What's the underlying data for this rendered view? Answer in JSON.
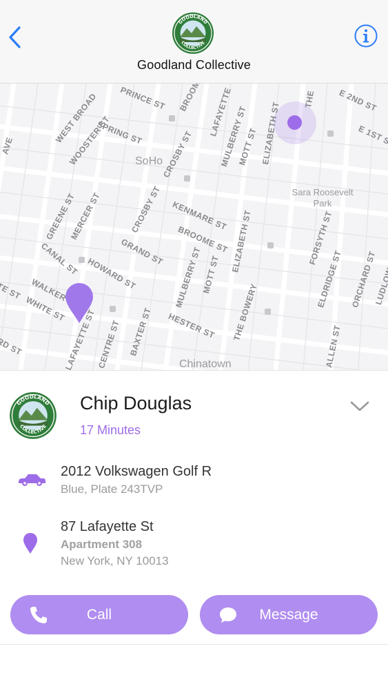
{
  "header": {
    "title": "Goodland Collective",
    "back_icon": "chevron-left-icon",
    "info_icon": "info-icon",
    "logo_name": "goodland-collective-logo",
    "logo_text_top": "GOODLAND",
    "logo_text_bottom": "COLLECTIVE"
  },
  "map": {
    "area_labels": [
      "SoHo",
      "Chinatown"
    ],
    "park_label": [
      "Sara Roosevelt",
      "Park"
    ],
    "streets": [
      "PRINCE ST",
      "WEST BROAD",
      "WOOSTER ST",
      "SPRING ST",
      "BROOME",
      "LAFAYETTE",
      "MULBERRY ST",
      "MOTT ST",
      "ELIZABETH ST",
      "THE",
      "E 2ND ST",
      "E 1ST S",
      "CROSBY ST",
      "GREENE ST",
      "MERCER ST",
      "KENMARE ST",
      "BROOME ST",
      "CANAL ST",
      "HOWARD ST",
      "GRAND ST",
      "CROSBY ST",
      "MULBERRY ST",
      "MOTT ST",
      "ELIZABETH ST",
      "FORSYTH ST",
      "ELDRIDGE ST",
      "ORCHARD ST",
      "LUDLOW",
      "WALKER",
      "WHITE ST",
      "TE ST",
      "LAFAYETTE ST",
      "CENTRE ST",
      "BAXTER ST",
      "HESTER ST",
      "THE BOWERY",
      "ALLEN ST",
      "RD ST",
      "AVE"
    ],
    "accent_color": "#9d6ce8"
  },
  "driver": {
    "name": "Chip Douglas",
    "eta": "17 Minutes",
    "collapse_icon": "chevron-down-icon"
  },
  "vehicle": {
    "icon": "car-icon",
    "title": "2012 Volkswagen Golf R",
    "subtitle": "Blue, Plate 243TVP"
  },
  "destination": {
    "icon": "location-pin-icon",
    "address": "87 Lafayette St",
    "unit": "Apartment 308",
    "city": "New York, NY 10013"
  },
  "actions": {
    "call_label": "Call",
    "message_label": "Message",
    "call_icon": "phone-icon",
    "message_icon": "chat-bubble-icon",
    "button_color": "#b08df0"
  }
}
